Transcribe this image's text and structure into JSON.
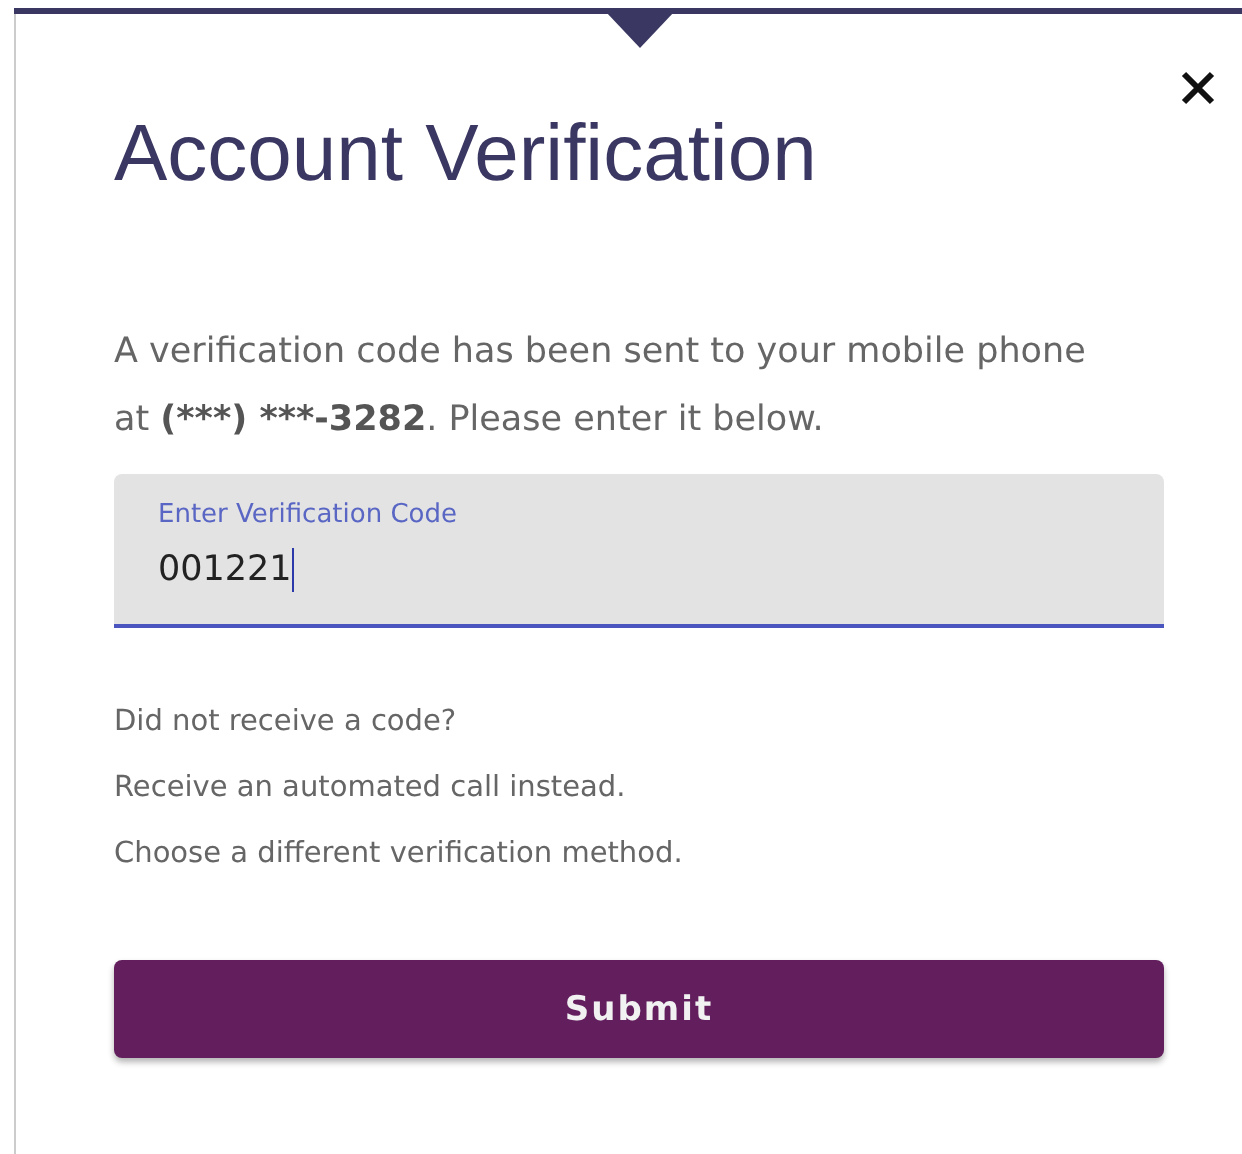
{
  "dialog": {
    "title": "Account Verification",
    "message_start": "A verification code has been sent to your mobile phone at ",
    "phone": "(***) ***-3282",
    "message_end": ". Please enter it below."
  },
  "code_field": {
    "label": "Enter Verification Code",
    "value": "001221",
    "focused": true
  },
  "help_question": "Did not receive a code?",
  "help_links": [
    "Receive an automated call instead.",
    "Choose a different verification method."
  ],
  "submit": "Submit"
}
